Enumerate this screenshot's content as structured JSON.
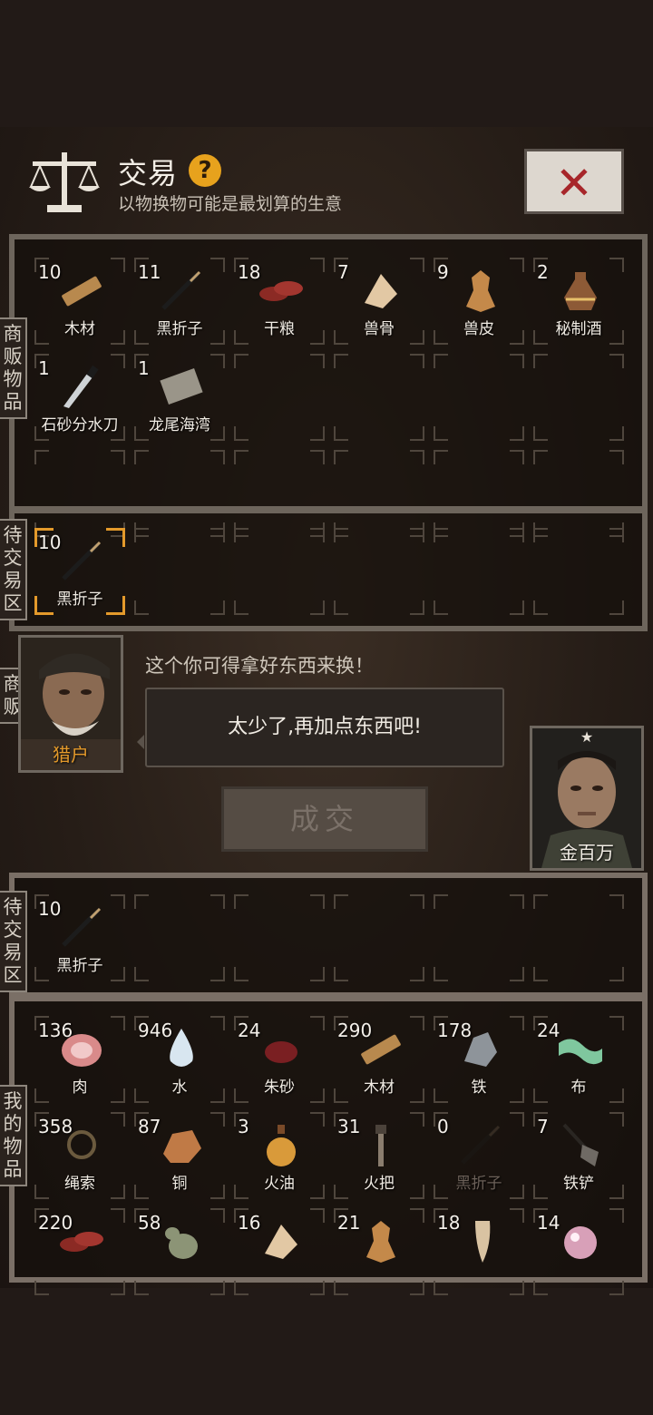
{
  "header": {
    "title": "交易",
    "help_glyph": "?",
    "subtitle": "以物换物可能是最划算的生意",
    "close_glyph": "✕"
  },
  "labels": {
    "merchant_items": "商贩物品",
    "merchant_pending": "待交易区",
    "merchant": "商贩",
    "my_pending": "待交易区",
    "my_items": "我的物品"
  },
  "merchant": {
    "name": "猎户",
    "line": "这个你可得拿好东西来换！",
    "reply": "太少了,再加点东西吧!"
  },
  "player": {
    "name": "金百万",
    "rank_mark": "★"
  },
  "deal_button": "成交",
  "merchant_items": [
    {
      "count": "10",
      "name": "木材",
      "icon": "wood-icon",
      "color": "#b8894e"
    },
    {
      "count": "11",
      "name": "黑折子",
      "icon": "fire-striker-icon",
      "color": "#c0a070"
    },
    {
      "count": "18",
      "name": "干粮",
      "icon": "dried-meat-icon",
      "color": "#8b2a24"
    },
    {
      "count": "7",
      "name": "兽骨",
      "icon": "beast-bone-icon",
      "color": "#e2c8a4"
    },
    {
      "count": "9",
      "name": "兽皮",
      "icon": "beast-hide-icon",
      "color": "#c4894a"
    },
    {
      "count": "2",
      "name": "秘制酒",
      "icon": "wine-jar-icon",
      "color": "#8d5a36"
    },
    {
      "count": "1",
      "name": "石砂分水刀",
      "icon": "knife-icon",
      "color": "#cfd3d6"
    },
    {
      "count": "1",
      "name": "龙尾海湾",
      "icon": "map-icon",
      "color": "#9a9589"
    }
  ],
  "merchant_pending": [
    {
      "count": "10",
      "name": "黑折子",
      "icon": "fire-striker-icon",
      "color": "#c0a070",
      "selected": true
    }
  ],
  "my_pending": [
    {
      "count": "10",
      "name": "黑折子",
      "icon": "fire-striker-icon",
      "color": "#c0a070"
    }
  ],
  "my_items": [
    {
      "count": "136",
      "name": "肉",
      "icon": "meat-icon",
      "color": "#d98a8a"
    },
    {
      "count": "946",
      "name": "水",
      "icon": "water-drop-icon",
      "color": "#d8e6f0"
    },
    {
      "count": "24",
      "name": "朱砂",
      "icon": "cinnabar-icon",
      "color": "#7a1f22"
    },
    {
      "count": "290",
      "name": "木材",
      "icon": "wood-icon",
      "color": "#b8894e"
    },
    {
      "count": "178",
      "name": "铁",
      "icon": "iron-ore-icon",
      "color": "#8e949a"
    },
    {
      "count": "24",
      "name": "布",
      "icon": "cloth-icon",
      "color": "#7fc79e"
    },
    {
      "count": "358",
      "name": "绳索",
      "icon": "rope-icon",
      "color": "#6b5a3e"
    },
    {
      "count": "87",
      "name": "铜",
      "icon": "copper-ore-icon",
      "color": "#c07a46"
    },
    {
      "count": "3",
      "name": "火油",
      "icon": "oil-bottle-icon",
      "color": "#d99a3a"
    },
    {
      "count": "31",
      "name": "火把",
      "icon": "torch-icon",
      "color": "#8a7d6e"
    },
    {
      "count": "0",
      "name": "黑折子",
      "icon": "fire-striker-icon",
      "color": "#6b5a48",
      "dim": true
    },
    {
      "count": "7",
      "name": "铁铲",
      "icon": "shovel-icon",
      "color": "#6f6a64"
    },
    {
      "count": "220",
      "name": "",
      "icon": "dried-meat-icon",
      "color": "#8b2a24"
    },
    {
      "count": "58",
      "name": "",
      "icon": "gourd-icon",
      "color": "#8c9476"
    },
    {
      "count": "16",
      "name": "",
      "icon": "beast-bone-icon",
      "color": "#e2c8a4"
    },
    {
      "count": "21",
      "name": "",
      "icon": "beast-hide-icon",
      "color": "#c4894a"
    },
    {
      "count": "18",
      "name": "",
      "icon": "tooth-icon",
      "color": "#d9c3a2"
    },
    {
      "count": "14",
      "name": "",
      "icon": "pearl-icon",
      "color": "#d8a0b8"
    }
  ]
}
